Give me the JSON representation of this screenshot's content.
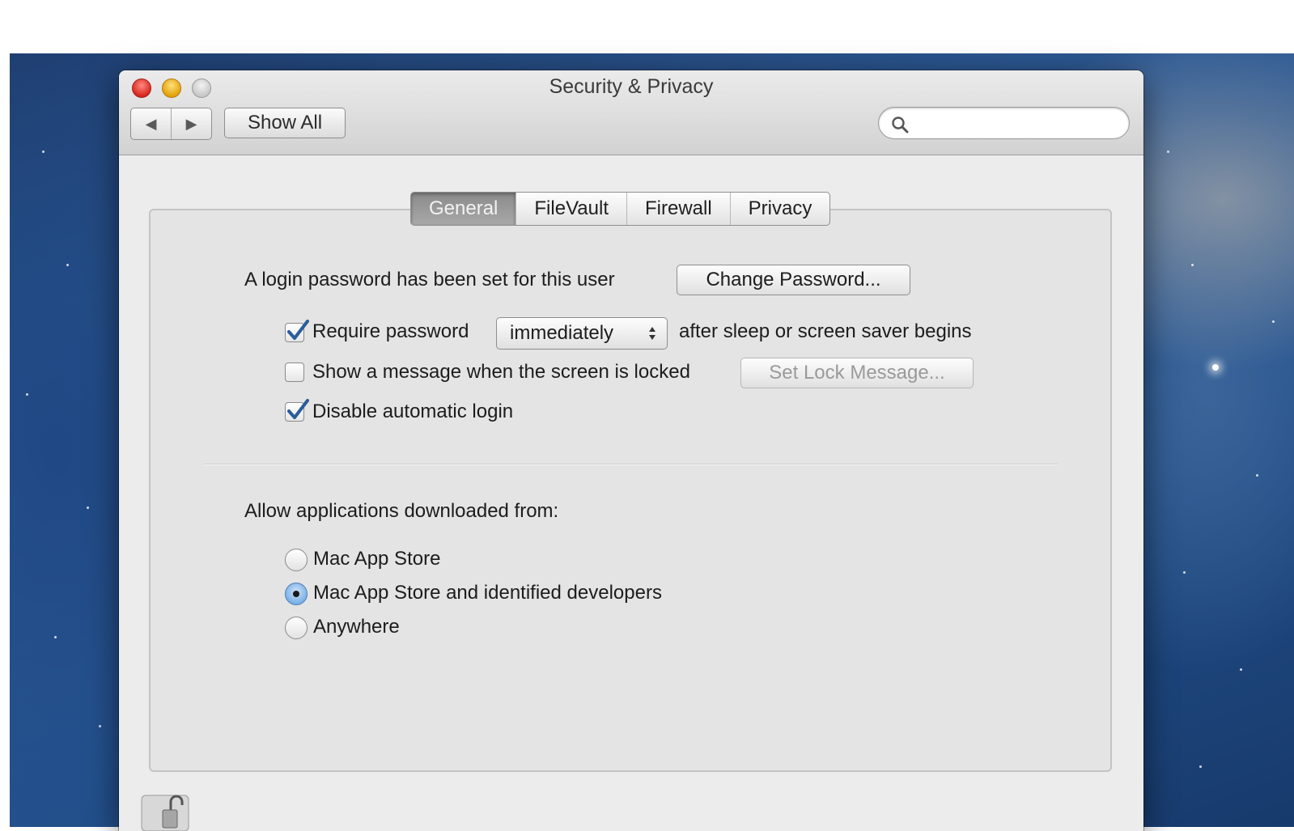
{
  "window": {
    "title": "Security & Privacy",
    "nav_back": "◀",
    "nav_forward": "▶",
    "show_all_label": "Show All",
    "search": {
      "value": "",
      "placeholder": ""
    }
  },
  "tabs": [
    {
      "label": "General",
      "selected": true
    },
    {
      "label": "FileVault",
      "selected": false
    },
    {
      "label": "Firewall",
      "selected": false
    },
    {
      "label": "Privacy",
      "selected": false
    }
  ],
  "general": {
    "login_password_text": "A login password has been set for this user",
    "change_password_label": "Change Password...",
    "require_password": {
      "checked": true,
      "label": "Require password",
      "delay_selected": "immediately",
      "suffix": "after sleep or screen saver begins"
    },
    "show_message": {
      "checked": false,
      "label": "Show a message when the screen is locked",
      "button_label": "Set Lock Message..."
    },
    "disable_auto_login": {
      "checked": true,
      "label": "Disable automatic login"
    },
    "allow_apps": {
      "heading": "Allow applications downloaded from:",
      "options": [
        {
          "label": "Mac App Store",
          "selected": false
        },
        {
          "label": "Mac App Store and identified developers",
          "selected": true
        },
        {
          "label": "Anywhere",
          "selected": false
        }
      ]
    }
  },
  "colors": {
    "checkbox_check": "#2a5c9a",
    "radio_selected": "#6fa8e4",
    "tab_selected_bg": "#8a8a8a"
  },
  "icons": {
    "close": "close-icon",
    "minimize": "minimize-icon",
    "zoom": "zoom-icon",
    "search": "search-icon",
    "lock": "lock-icon"
  }
}
